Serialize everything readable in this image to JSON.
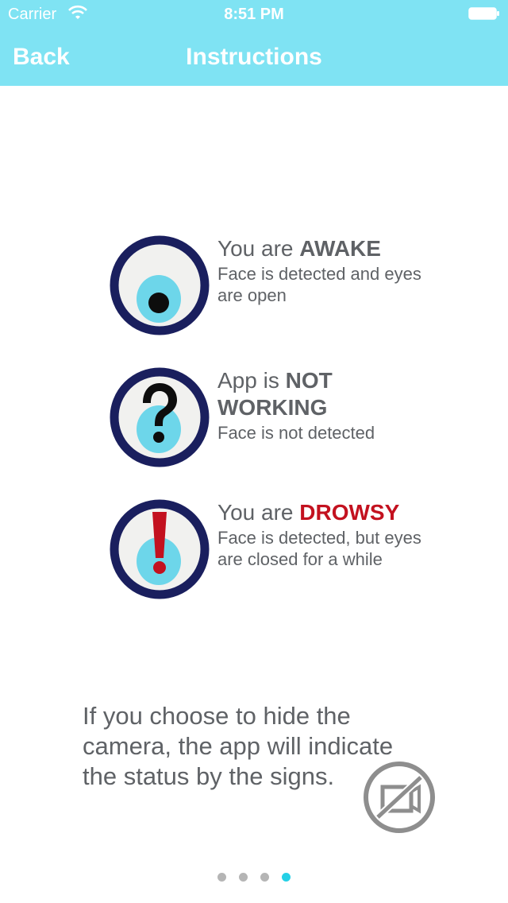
{
  "status_bar": {
    "carrier": "Carrier",
    "time": "8:51 PM"
  },
  "nav": {
    "back_label": "Back",
    "title": "Instructions"
  },
  "states": [
    {
      "headline_prefix": "You are ",
      "headline_strong": "AWAKE",
      "description": "Face is detected and eyes are open",
      "icon": "eye-open-icon"
    },
    {
      "headline_prefix": "App is ",
      "headline_strong": "NOT WORKING",
      "description": "Face is not detected",
      "icon": "question-mark-icon"
    },
    {
      "headline_prefix": "You are ",
      "headline_strong": "DROWSY",
      "description": "Face is detected, but eyes are closed for a while",
      "icon": "exclamation-icon"
    }
  ],
  "note": "If you choose to hide the camera, the app will indicate the status by the signs.",
  "pager": {
    "count": 4,
    "active_index": 3
  },
  "colors": {
    "nav_bar": "#7fe3f3",
    "icon_ring": "#1a1f5e",
    "icon_pupil_bg": "#6dd6ea",
    "alert_red": "#c3111f",
    "active_dot": "#25d0e6"
  }
}
